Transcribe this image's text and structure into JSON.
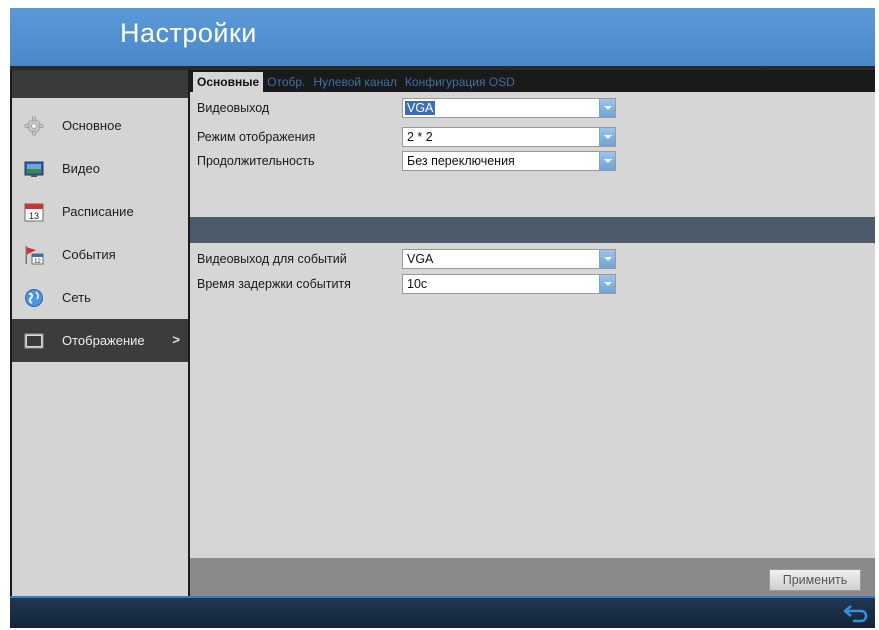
{
  "header": {
    "title": "Настройки"
  },
  "sidebar": {
    "items": [
      {
        "label": "Основное",
        "icon": "gear-icon"
      },
      {
        "label": "Видео",
        "icon": "video-icon"
      },
      {
        "label": "Расписание",
        "icon": "calendar-icon"
      },
      {
        "label": "События",
        "icon": "events-icon"
      },
      {
        "label": "Сеть",
        "icon": "globe-icon"
      },
      {
        "label": "Отображение",
        "icon": "monitor-icon",
        "active": true,
        "chevron": ">"
      }
    ]
  },
  "tabs": [
    {
      "label": "Основные",
      "active": true
    },
    {
      "label": "Отобр."
    },
    {
      "label": "Нулевой канал"
    },
    {
      "label": "Конфигурация OSD"
    }
  ],
  "form": {
    "video_out": {
      "label": "Видеовыход",
      "value": "VGA"
    },
    "display_mode": {
      "label": "Режим отображения",
      "value": "2 * 2"
    },
    "duration": {
      "label": "Продолжительность",
      "value": "Без переключения"
    },
    "event_video_out": {
      "label": "Видеовыход для событий",
      "value": "VGA"
    },
    "event_delay": {
      "label": "Время задержки событитя",
      "value": "10с"
    }
  },
  "footer": {
    "apply_label": "Применить"
  },
  "colors": {
    "accent": "#4a87c8",
    "selection": "#3d6eb5",
    "tab_inactive": "#3f6fa5"
  }
}
